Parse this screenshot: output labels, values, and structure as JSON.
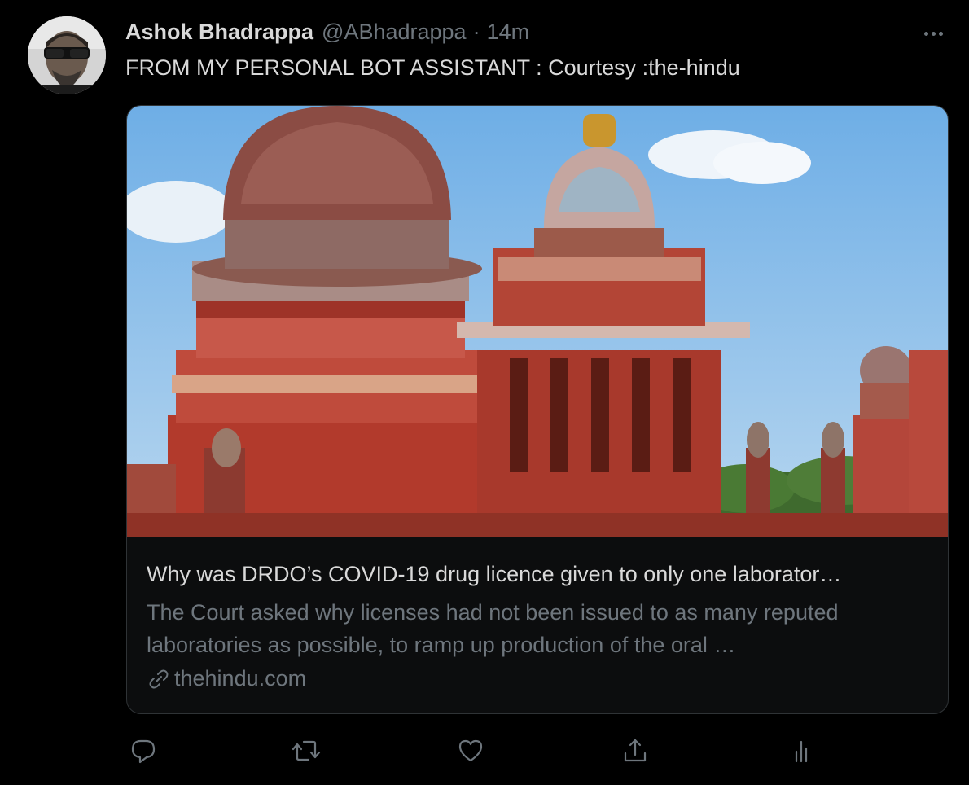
{
  "tweet": {
    "author_name": "Ashok Bhadrappa",
    "author_handle": "@ABhadrappa",
    "separator": "·",
    "time": "14m",
    "text": "FROM MY PERSONAL BOT ASSISTANT : Courtesy :the-hindu",
    "more_icon": "more-horizontal-icon"
  },
  "card": {
    "title": "Why was DRDO’s COVID-19 drug licence given to only one laborator…",
    "description": "The Court asked why licenses had not been issued to as many reputed laboratories as possible, to ramp up production of the oral …",
    "domain": "thehindu.com",
    "domain_icon": "link-icon"
  },
  "actions": [
    {
      "icon": "reply-icon"
    },
    {
      "icon": "retweet-icon"
    },
    {
      "icon": "like-icon"
    },
    {
      "icon": "share-icon"
    },
    {
      "icon": "analytics-icon"
    }
  ],
  "colors": {
    "background": "#000000",
    "text_primary": "#d9d9d9",
    "text_secondary": "#6e767d",
    "border": "#2f3336"
  }
}
